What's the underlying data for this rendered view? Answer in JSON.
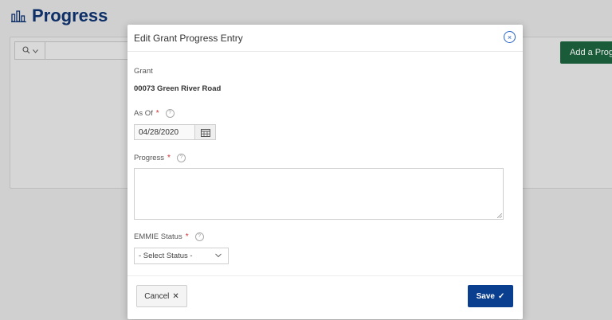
{
  "page": {
    "title": "Progress",
    "add_button_label": "Add a Progre"
  },
  "dialog": {
    "title": "Edit Grant Progress Entry",
    "grant": {
      "label": "Grant",
      "value": "00073 Green River Road"
    },
    "as_of": {
      "label": "As Of",
      "value": "04/28/2020",
      "required_marker": "*"
    },
    "progress": {
      "label": "Progress",
      "value": "",
      "required_marker": "*"
    },
    "emmie_status": {
      "label": "EMMIE Status",
      "selected": "- Select Status -",
      "required_marker": "*"
    },
    "help_glyph": "?",
    "close_glyph": "×",
    "footer": {
      "cancel_label": "Cancel",
      "cancel_glyph": "✕",
      "save_label": "Save",
      "save_glyph": "✓"
    }
  },
  "colors": {
    "accent": "#0a3e8e",
    "add_button": "#1a5c3a",
    "required": "#d32f2f",
    "title": "#0d2e66"
  },
  "icons": [
    "chart-bars-icon",
    "search-icon",
    "chevron-down-icon",
    "close-icon",
    "help-icon",
    "calendar-icon",
    "x-icon",
    "check-icon"
  ]
}
